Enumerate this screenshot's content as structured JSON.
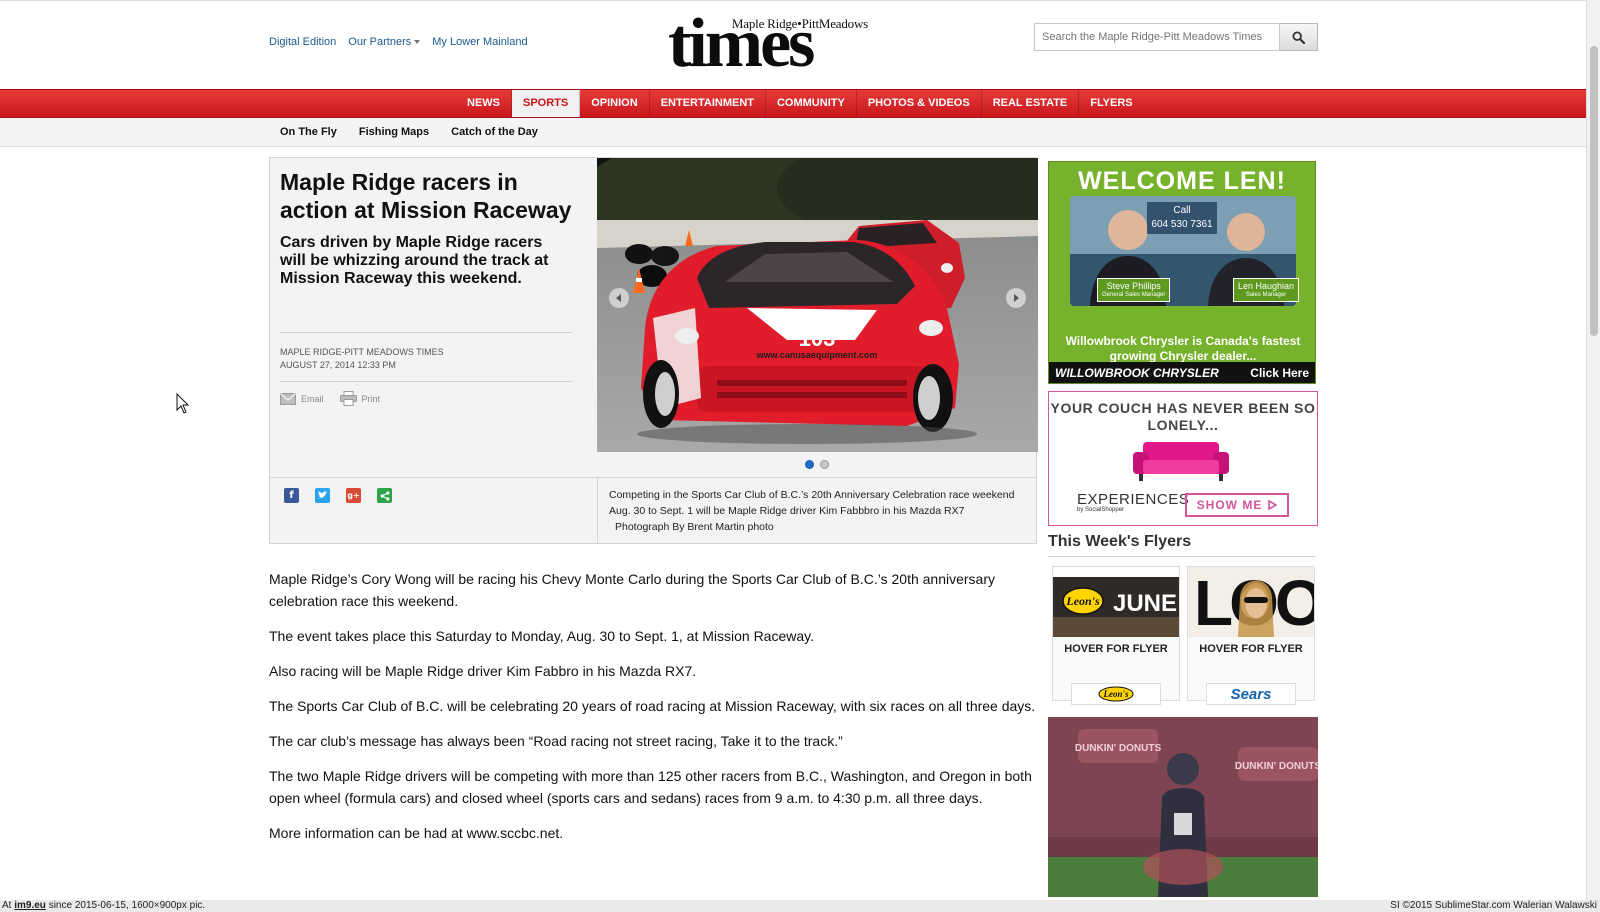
{
  "header": {
    "top_links": [
      "Digital Edition",
      "Our Partners",
      "My Lower Mainland"
    ],
    "logo_tagline": "Maple Ridge•PittMeadows",
    "logo_main": "times",
    "search_placeholder": "Search the Maple Ridge-Pitt Meadows Times"
  },
  "nav": {
    "items": [
      "NEWS",
      "SPORTS",
      "OPINION",
      "ENTERTAINMENT",
      "COMMUNITY",
      "PHOTOS & VIDEOS",
      "REAL ESTATE",
      "FLYERS"
    ],
    "active": "SPORTS"
  },
  "subnav": {
    "items": [
      "On The Fly",
      "Fishing Maps",
      "Catch of the Day"
    ]
  },
  "article": {
    "headline": "Maple Ridge racers in action at Mission Raceway",
    "dek": "Cars driven by Maple Ridge racers will be whizzing around the track at Mission Raceway this weekend.",
    "source": "MAPLE RIDGE-PITT MEADOWS TIMES",
    "date": "AUGUST 27, 2014 12:33 PM",
    "tools": [
      "Email",
      "Print"
    ],
    "photo": {
      "car_number": "103",
      "car_url": "www.canusaequipment.com",
      "caption": "Competing in the Sports Car Club of B.C.’s 20th Anniversary Celebration race weekend Aug. 30 to Sept. 1 will be Maple Ridge driver Kim Fabbbro in his Mazda RX7",
      "credit": "Photograph By Brent Martin photo",
      "slide_count": 2,
      "active_slide": 1
    },
    "share": [
      "facebook",
      "twitter",
      "google-plus",
      "share"
    ],
    "paragraphs": [
      "Maple Ridge’s Cory Wong will be racing his Chevy Monte Carlo during the Sports Car Club of B.C.’s 20th anniversary celebration race this weekend.",
      "The event takes place this Saturday to Monday, Aug. 30 to Sept. 1, at Mission Raceway.",
      "Also racing will be Maple Ridge driver Kim Fabbro in his Mazda RX7.",
      "The Sports Car Club of B.C. will be celebrating 20 years of road racing at Mission Raceway, with six races on all three days.",
      "The car club’s message has always been “Road racing not street racing, Take it to the track.”",
      "The two Maple Ridge drivers will be competing with more than 125 other racers from B.C., Washington, and Oregon in both open wheel (formula cars) and closed wheel (sports cars and sedans) races from 9 a.m. to 4:30 p.m. all three days.",
      "More information can be had at www.sccbc.net."
    ]
  },
  "sidebar": {
    "ad1": {
      "title": "WELCOME LEN!",
      "call": "Call",
      "phone": "604 530 7361",
      "person1_name": "Steve Phillips",
      "person1_role": "General Sales Manager",
      "person2_name": "Len Haughian",
      "person2_role": "Sales Manager",
      "text": "Willowbrook Chrysler is Canada's fastest growing Chrysler dealer...",
      "brand": "WILLOWBROOK CHRYSLER",
      "cta": "Click Here"
    },
    "ad2": {
      "title": "YOUR COUCH HAS NEVER BEEN SO LONELY...",
      "logo": "EXPERIENCES",
      "logo_sub": "by SocialShopper",
      "cta": "SHOW ME"
    },
    "flyers": {
      "title": "This Week's Flyers",
      "items": [
        {
          "hover": "HOVER FOR FLYER",
          "brand": "Leon's",
          "cover_text": "JUNE",
          "cover_logo": "Leon's"
        },
        {
          "hover": "HOVER FOR FLYER",
          "brand": "Sears",
          "cover_text": "LOO"
        }
      ]
    },
    "video": {
      "banner_text": "DUNKIN' DONUTS"
    }
  },
  "footer": {
    "left_prefix": "At ",
    "left_link": "im9.eu",
    "left_suffix": " since 2015-06-15, 1600×900px pic.",
    "right": "SI ©2015 SublimeStar.com Walerian Walawski"
  },
  "colors": {
    "nav_red": "#d3232a",
    "link_blue": "#1d5a8e",
    "ad_green": "#77b22c",
    "ad_pink": "#d2569c",
    "slide_dot_active": "#1c6ec9"
  }
}
